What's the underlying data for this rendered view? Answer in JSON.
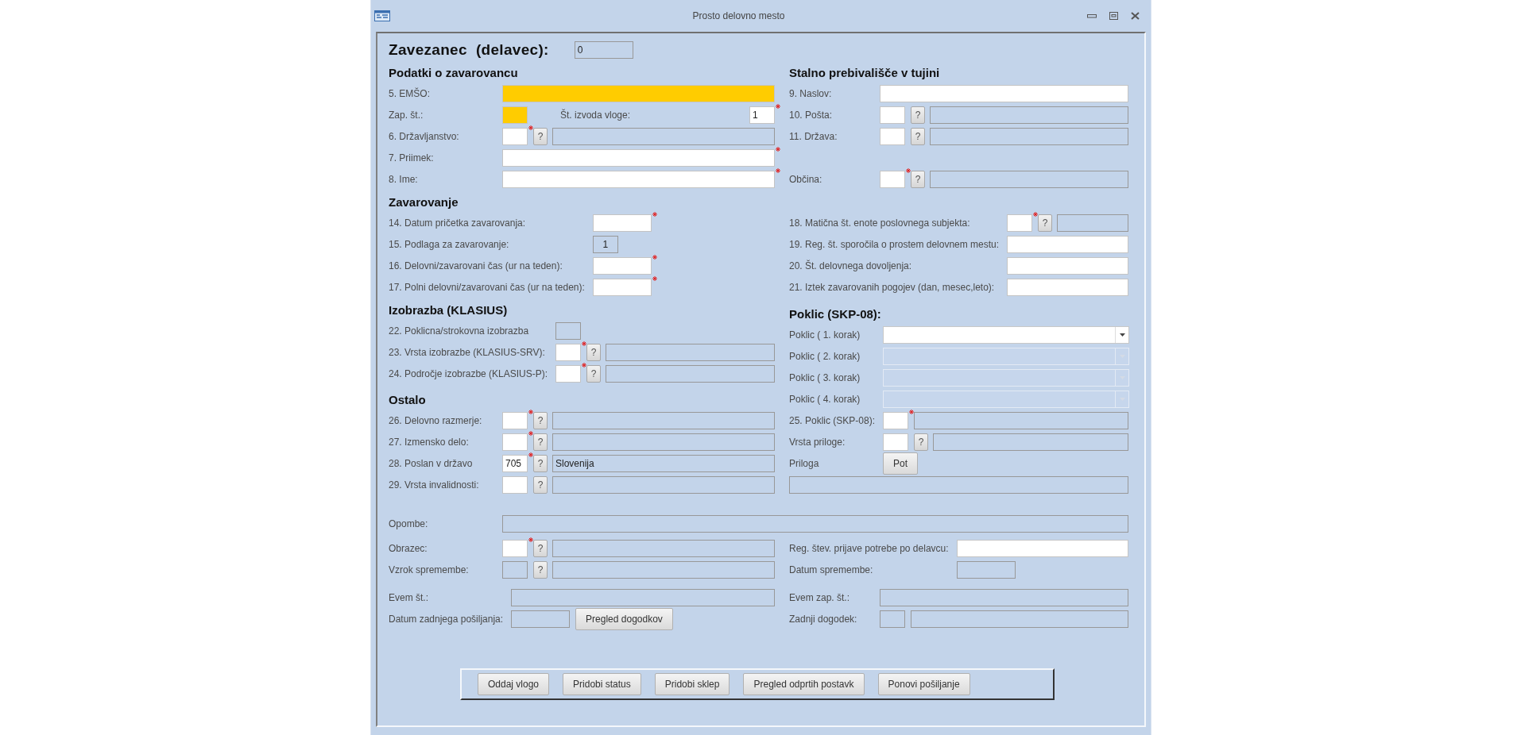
{
  "window": {
    "title": "Prosto delovno mesto"
  },
  "header": {
    "label": "Zavezanec  (delavec):",
    "value": "0"
  },
  "bands": [
    {
      "kind": "split",
      "left": [
        {
          "heading": "Podatki o zavarovancu",
          "rows": [
            {
              "label": "5. EMŠO:",
              "controls": [
                {
                  "kind": "text",
                  "readonly": false,
                  "highlighted": true,
                  "required": false
                }
              ]
            },
            {
              "label": "Zap. št.:",
              "controls": [
                {
                  "kind": "code",
                  "readonly": false,
                  "highlighted": true,
                  "required": false
                },
                {
                  "kind": "label",
                  "text": "Št. izvoda vloge:"
                },
                {
                  "kind": "code",
                  "readonly": false,
                  "highlighted": false,
                  "required": true,
                  "value": "1"
                }
              ]
            },
            {
              "label": "6. Državljanstvo:",
              "controls": [
                {
                  "kind": "code",
                  "readonly": false,
                  "highlighted": false,
                  "required": true
                },
                {
                  "kind": "lookup",
                  "text": "?"
                },
                {
                  "kind": "text",
                  "readonly": true,
                  "highlighted": false,
                  "required": false
                }
              ]
            },
            {
              "label": "7. Priimek:",
              "controls": [
                {
                  "kind": "text",
                  "readonly": false,
                  "highlighted": false,
                  "required": true
                }
              ]
            },
            {
              "label": "8. Ime:",
              "controls": [
                {
                  "kind": "text",
                  "readonly": false,
                  "highlighted": false,
                  "required": true
                }
              ]
            }
          ]
        }
      ],
      "right": [
        {
          "heading": "Stalno prebivališče v tujini",
          "rows": [
            {
              "label": "9. Naslov:",
              "controls": [
                {
                  "kind": "text",
                  "readonly": false,
                  "highlighted": false,
                  "required": false
                }
              ]
            },
            {
              "label": "10. Pošta:",
              "controls": [
                {
                  "kind": "code",
                  "readonly": false,
                  "highlighted": false,
                  "required": false
                },
                {
                  "kind": "lookup",
                  "text": "?"
                },
                {
                  "kind": "text",
                  "readonly": true,
                  "highlighted": false,
                  "required": false
                }
              ]
            },
            {
              "label": "11. Država:",
              "controls": [
                {
                  "kind": "code",
                  "readonly": false,
                  "highlighted": false,
                  "required": false
                },
                {
                  "kind": "lookup",
                  "text": "?"
                },
                {
                  "kind": "text",
                  "readonly": true,
                  "highlighted": false,
                  "required": false
                }
              ]
            }
          ]
        },
        {
          "rows": [
            {
              "label": "Občina:",
              "controls": [
                {
                  "kind": "code",
                  "readonly": false,
                  "highlighted": false,
                  "required": true
                },
                {
                  "kind": "lookup",
                  "text": "?"
                },
                {
                  "kind": "text",
                  "readonly": true,
                  "highlighted": false,
                  "required": false
                }
              ]
            }
          ]
        }
      ]
    },
    {
      "kind": "split",
      "left": [
        {
          "heading": "Zavarovanje",
          "rows": [
            {
              "label": "14. Datum pričetka zavarovanja:",
              "controls": [
                {
                  "kind": "number",
                  "readonly": false,
                  "highlighted": false,
                  "required": true
                }
              ]
            },
            {
              "label": "15. Podlaga za zavarovanje:",
              "controls": [
                {
                  "kind": "code",
                  "readonly": true,
                  "highlighted": false,
                  "required": false,
                  "value": "1"
                }
              ]
            },
            {
              "label": "16. Delovni/zavarovani čas (ur na teden):",
              "controls": [
                {
                  "kind": "number",
                  "readonly": false,
                  "highlighted": false,
                  "required": true
                }
              ]
            },
            {
              "label": "17. Polni delovni/zavarovani čas (ur na teden):",
              "controls": [
                {
                  "kind": "number",
                  "readonly": false,
                  "highlighted": false,
                  "required": true
                }
              ]
            }
          ]
        }
      ],
      "right": [
        {
          "rows": [
            {
              "label": "18. Matična št. enote poslovnega subjekta:",
              "controls": [
                {
                  "kind": "code",
                  "readonly": false,
                  "highlighted": false,
                  "required": true
                },
                {
                  "kind": "lookup",
                  "text": "?"
                },
                {
                  "kind": "text",
                  "readonly": true,
                  "highlighted": false,
                  "required": false
                }
              ]
            },
            {
              "label": "19. Reg. št. sporočila o prostem delovnem mestu:",
              "controls": [
                {
                  "kind": "text",
                  "readonly": false,
                  "highlighted": false,
                  "required": false
                }
              ]
            },
            {
              "label": "20. Št. delovnega dovoljenja:",
              "controls": [
                {
                  "kind": "text",
                  "readonly": false,
                  "highlighted": false,
                  "required": false
                }
              ]
            },
            {
              "label": "21. Iztek zavarovanih pogojev (dan, mesec,leto):",
              "controls": [
                {
                  "kind": "text",
                  "readonly": false,
                  "highlighted": false,
                  "required": false
                }
              ]
            }
          ]
        }
      ]
    },
    {
      "kind": "split",
      "left": [
        {
          "heading": "Izobrazba (KLASIUS)",
          "rows": [
            {
              "label": "22. Poklicna/strokovna izobrazba",
              "controls": [
                {
                  "kind": "code",
                  "readonly": true,
                  "highlighted": false,
                  "required": false
                }
              ]
            },
            {
              "label": "23. Vrsta izobrazbe (KLASIUS-SRV):",
              "controls": [
                {
                  "kind": "code",
                  "readonly": false,
                  "highlighted": false,
                  "required": true
                },
                {
                  "kind": "lookup",
                  "text": "?"
                },
                {
                  "kind": "text",
                  "readonly": true,
                  "highlighted": false,
                  "required": false
                }
              ]
            },
            {
              "label": "24. Področje izobrazbe (KLASIUS-P):",
              "controls": [
                {
                  "kind": "code",
                  "readonly": false,
                  "highlighted": false,
                  "required": true
                },
                {
                  "kind": "lookup",
                  "text": "?"
                },
                {
                  "kind": "text",
                  "readonly": true,
                  "highlighted": false,
                  "required": false
                }
              ]
            }
          ]
        },
        {
          "heading": "Ostalo",
          "rows": [
            {
              "label": "26. Delovno razmerje:",
              "controls": [
                {
                  "kind": "code",
                  "readonly": false,
                  "highlighted": false,
                  "required": true
                },
                {
                  "kind": "lookup",
                  "text": "?"
                },
                {
                  "kind": "text",
                  "readonly": true,
                  "highlighted": false,
                  "required": false
                }
              ]
            },
            {
              "label": "27. Izmensko delo:",
              "controls": [
                {
                  "kind": "code",
                  "readonly": false,
                  "highlighted": false,
                  "required": true
                },
                {
                  "kind": "lookup",
                  "text": "?"
                },
                {
                  "kind": "text",
                  "readonly": true,
                  "highlighted": false,
                  "required": false
                }
              ]
            },
            {
              "label": "28. Poslan v državo",
              "controls": [
                {
                  "kind": "code",
                  "readonly": false,
                  "highlighted": false,
                  "required": true,
                  "value": "705"
                },
                {
                  "kind": "lookup",
                  "text": "?"
                },
                {
                  "kind": "text",
                  "readonly": true,
                  "highlighted": false,
                  "required": false,
                  "value": "Slovenija"
                }
              ]
            },
            {
              "label": "29. Vrsta invalidnosti:",
              "controls": [
                {
                  "kind": "code",
                  "readonly": false,
                  "highlighted": false,
                  "required": false
                },
                {
                  "kind": "lookup",
                  "text": "?"
                },
                {
                  "kind": "text",
                  "readonly": true,
                  "highlighted": false,
                  "required": false
                }
              ]
            }
          ]
        }
      ],
      "right": [
        {
          "heading": "Poklic (SKP-08):",
          "rows": [
            {
              "label": "Poklic ( 1. korak)",
              "controls": [
                {
                  "kind": "combo",
                  "disabled": false
                }
              ]
            },
            {
              "label": "Poklic ( 2. korak)",
              "controls": [
                {
                  "kind": "combo",
                  "disabled": true
                }
              ]
            },
            {
              "label": "Poklic ( 3. korak)",
              "controls": [
                {
                  "kind": "combo",
                  "disabled": true
                }
              ]
            },
            {
              "label": "Poklic ( 4. korak)",
              "controls": [
                {
                  "kind": "combo",
                  "disabled": true
                }
              ]
            },
            {
              "label": "25. Poklic (SKP-08):",
              "controls": [
                {
                  "kind": "code",
                  "readonly": false,
                  "highlighted": false,
                  "required": true
                },
                {
                  "kind": "text",
                  "readonly": true,
                  "highlighted": false,
                  "required": false
                }
              ]
            },
            {
              "label": "Vrsta priloge:",
              "controls": [
                {
                  "kind": "code",
                  "readonly": false,
                  "highlighted": false,
                  "required": false
                },
                {
                  "kind": "lookup",
                  "text": "?"
                },
                {
                  "kind": "text",
                  "readonly": true,
                  "highlighted": false,
                  "required": false
                }
              ]
            },
            {
              "label": "Priloga",
              "controls": [
                {
                  "kind": "button",
                  "text": "Pot"
                }
              ]
            },
            {
              "controls": [
                {
                  "kind": "text",
                  "readonly": true,
                  "highlighted": false,
                  "required": false
                }
              ]
            }
          ]
        }
      ]
    },
    {
      "kind": "full",
      "rows": [
        {
          "label": "Opombe:",
          "controls": [
            {
              "kind": "text",
              "readonly": true,
              "highlighted": false,
              "required": false
            }
          ]
        }
      ]
    },
    {
      "kind": "split",
      "left": [
        {
          "rows": [
            {
              "label": "Obrazec:",
              "controls": [
                {
                  "kind": "code",
                  "readonly": false,
                  "highlighted": false,
                  "required": true
                },
                {
                  "kind": "lookup",
                  "text": "?"
                },
                {
                  "kind": "text",
                  "readonly": true,
                  "highlighted": false,
                  "required": false
                }
              ]
            },
            {
              "label": "Vzrok spremembe:",
              "controls": [
                {
                  "kind": "code",
                  "readonly": true,
                  "highlighted": false,
                  "required": false
                },
                {
                  "kind": "lookup",
                  "text": "?"
                },
                {
                  "kind": "text",
                  "readonly": true,
                  "highlighted": false,
                  "required": false
                }
              ]
            }
          ]
        },
        {
          "rows": [
            {
              "label": "Evem št.:",
              "controls": [
                {
                  "kind": "text",
                  "readonly": true,
                  "highlighted": false,
                  "required": false
                }
              ]
            },
            {
              "label": "Datum zadnjega pošiljanja:",
              "controls": [
                {
                  "kind": "number",
                  "readonly": true,
                  "highlighted": false,
                  "required": false
                },
                {
                  "kind": "button",
                  "text": "Pregled dogodkov"
                }
              ]
            }
          ]
        }
      ],
      "right": [
        {
          "rows": [
            {
              "label": "Reg. štev. prijave potrebe po delavcu:",
              "controls": [
                {
                  "kind": "text",
                  "readonly": false,
                  "highlighted": false,
                  "required": false
                }
              ]
            },
            {
              "label": "Datum spremembe:",
              "controls": [
                {
                  "kind": "number",
                  "readonly": true,
                  "highlighted": false,
                  "required": false
                }
              ]
            }
          ]
        },
        {
          "rows": [
            {
              "label": "Evem zap. št.:",
              "controls": [
                {
                  "kind": "text",
                  "readonly": true,
                  "highlighted": false,
                  "required": false
                }
              ]
            },
            {
              "label": "Zadnji dogodek:",
              "controls": [
                {
                  "kind": "code",
                  "readonly": true,
                  "highlighted": false,
                  "required": false
                },
                {
                  "kind": "text",
                  "readonly": true,
                  "highlighted": false,
                  "required": false
                }
              ]
            }
          ]
        }
      ]
    }
  ],
  "actions": [
    "Oddaj vlogo",
    "Pridobi status",
    "Pridobi sklep",
    "Pregled odprtih postavk",
    "Ponovi pošiljanje"
  ]
}
